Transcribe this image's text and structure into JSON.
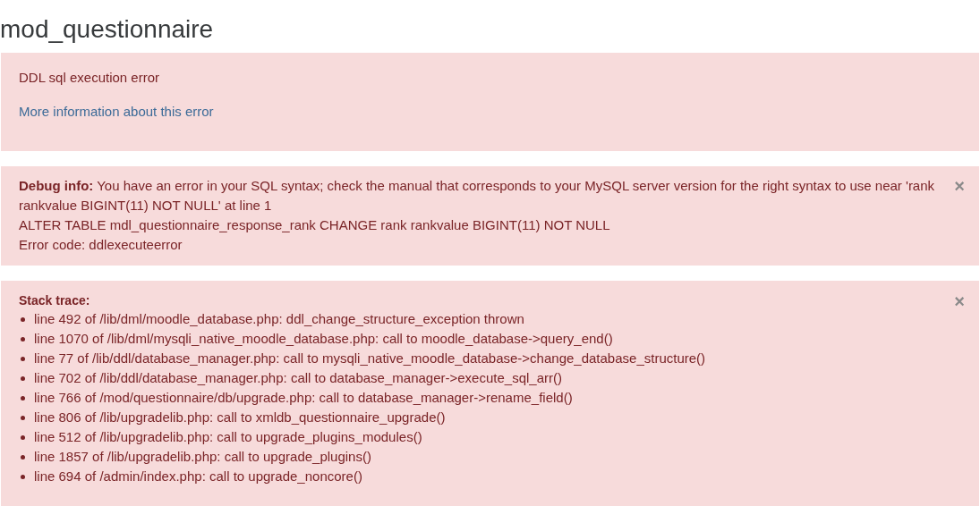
{
  "page_title": "mod_questionnaire",
  "error_box": {
    "message": "DDL sql execution error",
    "link": "More information about this error"
  },
  "debug_box": {
    "close": "×",
    "lines": [
      "**Debug info:** You have an error in your SQL syntax; check the manual that corresponds to your MySQL server version for the right syntax to use near 'rank rankvalue BIGINT(11) NOT NULL' at line 1",
      "ALTER TABLE mdl_questionnaire_response_rank CHANGE rank rankvalue BIGINT(11) NOT NULL",
      "Error code: ddlexecuteerror"
    ]
  },
  "stack_box": {
    "heading": "Stack trace:",
    "close": "×",
    "items": [
      "line 492 of /lib/dml/moodle_database.php: ddl_change_structure_exception thrown",
      "line 1070 of /lib/dml/mysqli_native_moodle_database.php: call to moodle_database->query_end()",
      "line 77 of /lib/ddl/database_manager.php: call to mysqli_native_moodle_database->change_database_structure()",
      "line 702 of /lib/ddl/database_manager.php: call to database_manager->execute_sql_arr()",
      "line 766 of /mod/questionnaire/db/upgrade.php: call to database_manager->rename_field()",
      "line 806 of /lib/upgradelib.php: call to xmldb_questionnaire_upgrade()",
      "line 512 of /lib/upgradelib.php: call to upgrade_plugins_modules()",
      "line 1857 of /lib/upgradelib.php: call to upgrade_plugins()",
      "line 694 of /admin/index.php: call to upgrade_noncore()"
    ]
  }
}
